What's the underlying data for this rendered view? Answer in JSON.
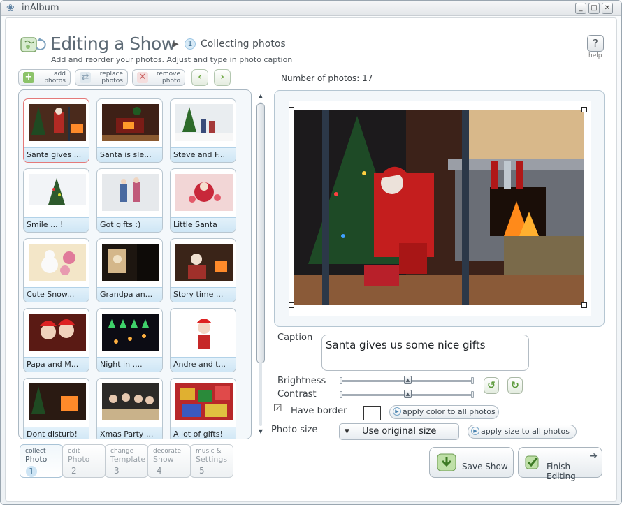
{
  "window": {
    "title": "inAlbum"
  },
  "header": {
    "title": "Editing a Show",
    "step_number": "1",
    "step_label": "Collecting photos",
    "subtitle": "Add and reorder your photos. Adjust and type in photo caption",
    "help_glyph": "?",
    "help_label": "help"
  },
  "toolbar": {
    "add": [
      "add",
      "photos"
    ],
    "replace": [
      "replace",
      "photos"
    ],
    "remove": [
      "remove",
      "photo"
    ]
  },
  "count": {
    "label": "Number of photos: 17",
    "value": 17
  },
  "gallery": {
    "selected_index": 0,
    "items": [
      {
        "caption": "Santa gives ..."
      },
      {
        "caption": "Santa is sle..."
      },
      {
        "caption": "Steve and F..."
      },
      {
        "caption": "Smile ... !"
      },
      {
        "caption": "Got gifts :)"
      },
      {
        "caption": "Little Santa"
      },
      {
        "caption": "Cute Snow..."
      },
      {
        "caption": "Grandpa an..."
      },
      {
        "caption": "Story time ..."
      },
      {
        "caption": "Papa and M..."
      },
      {
        "caption": "Night in ...."
      },
      {
        "caption": "Andre and t..."
      },
      {
        "caption": "Dont disturb!"
      },
      {
        "caption": "Xmas Party ..."
      },
      {
        "caption": "A lot of gifts!"
      }
    ]
  },
  "tabs": [
    {
      "small": "collect",
      "big": "Photo",
      "num": "1",
      "active": true
    },
    {
      "small": "edit",
      "big": "Photo",
      "num": "2",
      "active": false
    },
    {
      "small": "change",
      "big": "Template",
      "num": "3",
      "active": false
    },
    {
      "small": "decorate",
      "big": "Show",
      "num": "4",
      "active": false
    },
    {
      "small": "music &",
      "big": "Settings",
      "num": "5",
      "active": false
    }
  ],
  "editor": {
    "caption_label": "Caption",
    "caption_value": "Santa gives us some nice gifts",
    "brightness_label": "Brightness",
    "brightness_level": 0.5,
    "contrast_label": "Contrast",
    "contrast_level": 0.5,
    "border_label": "Have border",
    "border_checked": true,
    "apply_color": "apply color to all photos",
    "photo_size_label": "Photo size",
    "photo_size_value": "Use original size",
    "apply_size": "apply size to all photos"
  },
  "actions": {
    "save": "Save Show",
    "finish": "Finish Editing"
  },
  "colors": {
    "accent": "#4a84b0",
    "green": "#6aa53d",
    "caption_bg": "#d5eaf6",
    "selection": "#e47a7a"
  }
}
